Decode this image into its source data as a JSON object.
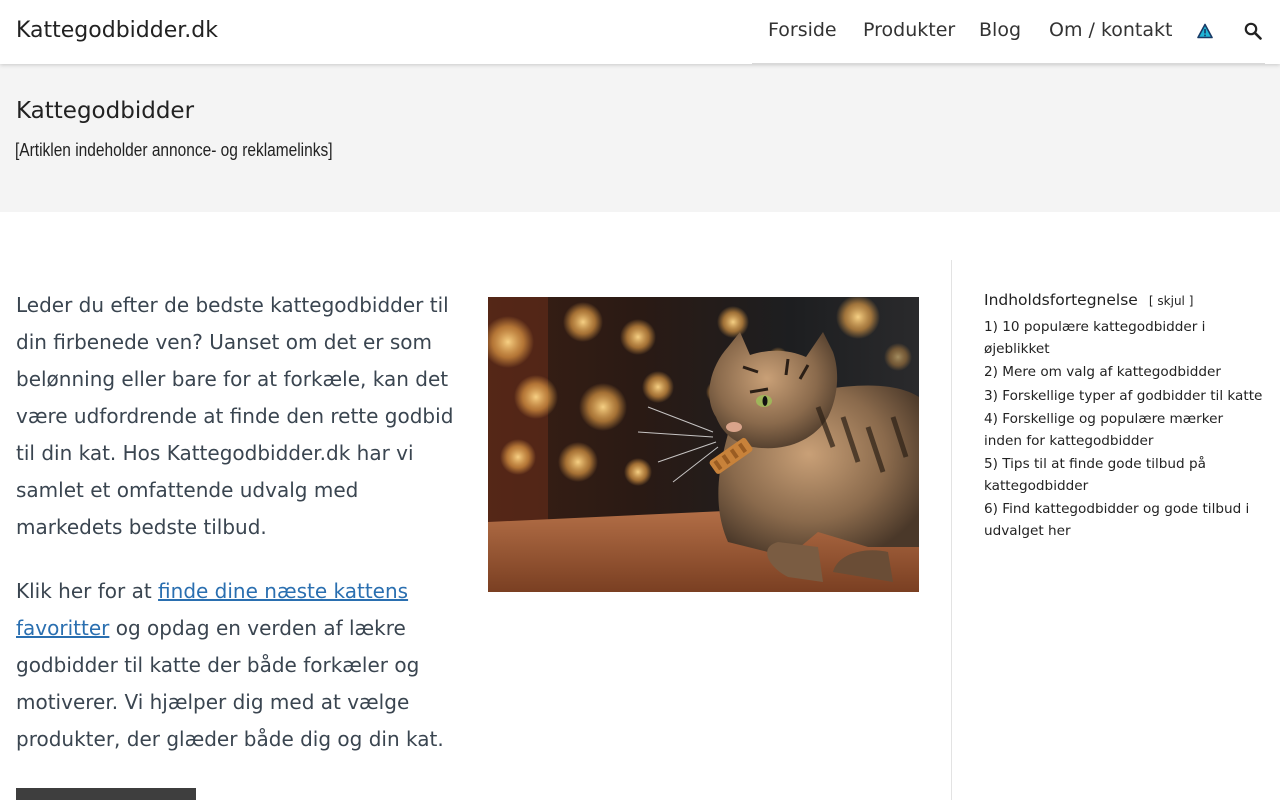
{
  "header": {
    "logo": "Kattegodbidder.dk",
    "nav": [
      {
        "label": "Forside"
      },
      {
        "label": "Produkter"
      },
      {
        "label": "Blog"
      },
      {
        "label": "Om / kontakt"
      }
    ],
    "icons": [
      "warning-triangle-icon",
      "search-icon"
    ],
    "accent_icon_color": "#1fb5d6"
  },
  "hero": {
    "title": "Kattegodbidder",
    "note": "[Artiklen indeholder annonce- og reklamelinks]"
  },
  "main": {
    "intro": "Leder du efter de bedste kattegodbidder til din firbenede ven? Uanset om det er som belønning eller bare for at forkæle, kan det være udfordrende at finde den rette godbid til din kat. Hos Kattegodbidder.dk har vi samlet et omfattende udvalg med markedets bedste tilbud.",
    "intro2_before": "Klik her for at ",
    "intro2_link": "finde dine næste kattens favoritter",
    "intro2_after": " og opdag en verden af lækre godbidder til katte der både forkæler og motiverer. Vi hjælper dig med at vælge produkter, der glæder både dig og din kat.",
    "link_color": "#2a6fb0"
  },
  "toc": {
    "heading": "Indholdsfortegnelse",
    "toggle": "[ skjul ]",
    "items": [
      "1) 10 populære kattegodbidder i øjeblikket",
      "2) Mere om valg af kattegodbidder",
      "3) Forskellige typer af godbidder til katte",
      "4) Forskellige og populære mærker inden for kattegodbidder",
      "5) Tips til at finde gode tilbud på kattegodbidder",
      "6) Find kattegodbidder og gode tilbud i udvalget her"
    ]
  }
}
